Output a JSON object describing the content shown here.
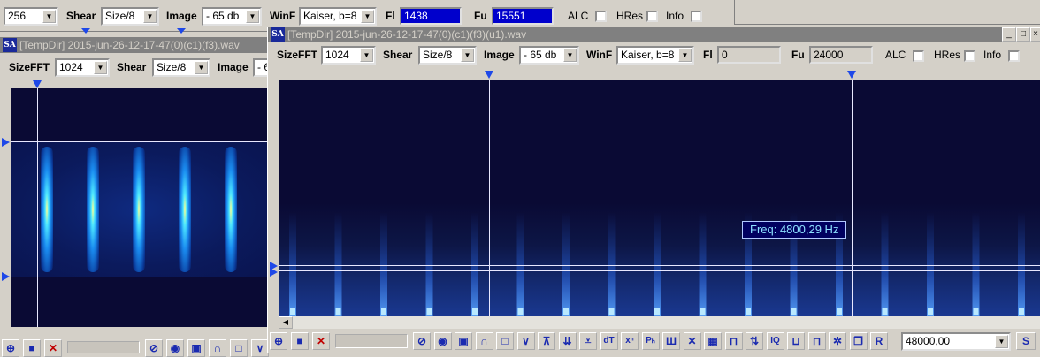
{
  "top_toolbar": {
    "sizefft_value": "256",
    "shear_label": "Shear",
    "shear_value": "Size/8",
    "image_label": "Image",
    "image_value": "- 65 db",
    "winf_label": "WinF",
    "winf_value": "Kaiser, b=8",
    "fl_label": "Fl",
    "fl_value": "1438",
    "fu_label": "Fu",
    "fu_value": "15551",
    "alc_label": "ALC",
    "hres_label": "HRes",
    "info_label": "Info"
  },
  "back_window": {
    "title": "[TempDir] 2015-jun-26-12-17-47(0)(c1)(f3).wav",
    "sizefft_label": "SizeFFT",
    "sizefft_value": "1024",
    "shear_label": "Shear",
    "shear_value": "Size/8",
    "image_label": "Image",
    "image_value": "- 6"
  },
  "front_window": {
    "title": "[TempDir] 2015-jun-26-12-17-47(0)(c1)(f3)(u1).wav",
    "sizefft_label": "SizeFFT",
    "sizefft_value": "1024",
    "shear_label": "Shear",
    "shear_value": "Size/8",
    "image_label": "Image",
    "image_value": "- 65 db",
    "winf_label": "WinF",
    "winf_value": "Kaiser, b=8",
    "fl_label": "Fl",
    "fl_value": "0",
    "fu_label": "Fu",
    "fu_value": "24000",
    "alc_label": "ALC",
    "hres_label": "HRes",
    "info_label": "Info",
    "tooltip": "Freq: 4800,29 Hz",
    "rate_value": "48000,00",
    "s_button": "S",
    "titlebar_buttons": [
      "_",
      "□",
      "×"
    ]
  },
  "tools": [
    {
      "icon": "zoom-icon",
      "glyph": "⊕"
    },
    {
      "icon": "stop-icon",
      "glyph": "■"
    },
    {
      "icon": "close-icon",
      "glyph": "✕"
    },
    {
      "icon": "no-icon",
      "glyph": "⊘"
    },
    {
      "icon": "speaker-icon",
      "glyph": "◉"
    },
    {
      "icon": "square-icon",
      "glyph": "▣"
    },
    {
      "icon": "arc-icon",
      "glyph": "∩"
    },
    {
      "icon": "rect-icon",
      "glyph": "□"
    },
    {
      "icon": "v-icon",
      "glyph": "∨"
    },
    {
      "icon": "tuner-icon",
      "glyph": "⊼"
    },
    {
      "icon": "down-arrows-icon",
      "glyph": "⇊"
    },
    {
      "icon": "merge-icon",
      "glyph": "⩡"
    },
    {
      "icon": "dt-icon",
      "glyph": "dT"
    },
    {
      "icon": "xn-icon",
      "glyph": "xⁿ"
    },
    {
      "icon": "ph-icon",
      "glyph": "Pₕ"
    },
    {
      "icon": "comb-icon",
      "glyph": "Ш"
    },
    {
      "icon": "cross-icon",
      "glyph": "✕"
    },
    {
      "icon": "grid-icon",
      "glyph": "▦"
    },
    {
      "icon": "pulse-icon",
      "glyph": "⊓"
    },
    {
      "icon": "updown-icon",
      "glyph": "⇅"
    },
    {
      "icon": "iq-icon",
      "glyph": "IQ"
    },
    {
      "icon": "wave-icon",
      "glyph": "⊔"
    },
    {
      "icon": "wave2-icon",
      "glyph": "⊓"
    },
    {
      "icon": "gear-icon",
      "glyph": "✲"
    },
    {
      "icon": "copy-icon",
      "glyph": "❐"
    },
    {
      "icon": "r-icon",
      "glyph": "R"
    }
  ],
  "colors": {
    "accent_blue": "#0000cc",
    "marker_blue": "#1e48e8",
    "spectrogram_bg": "#0a0a34"
  }
}
